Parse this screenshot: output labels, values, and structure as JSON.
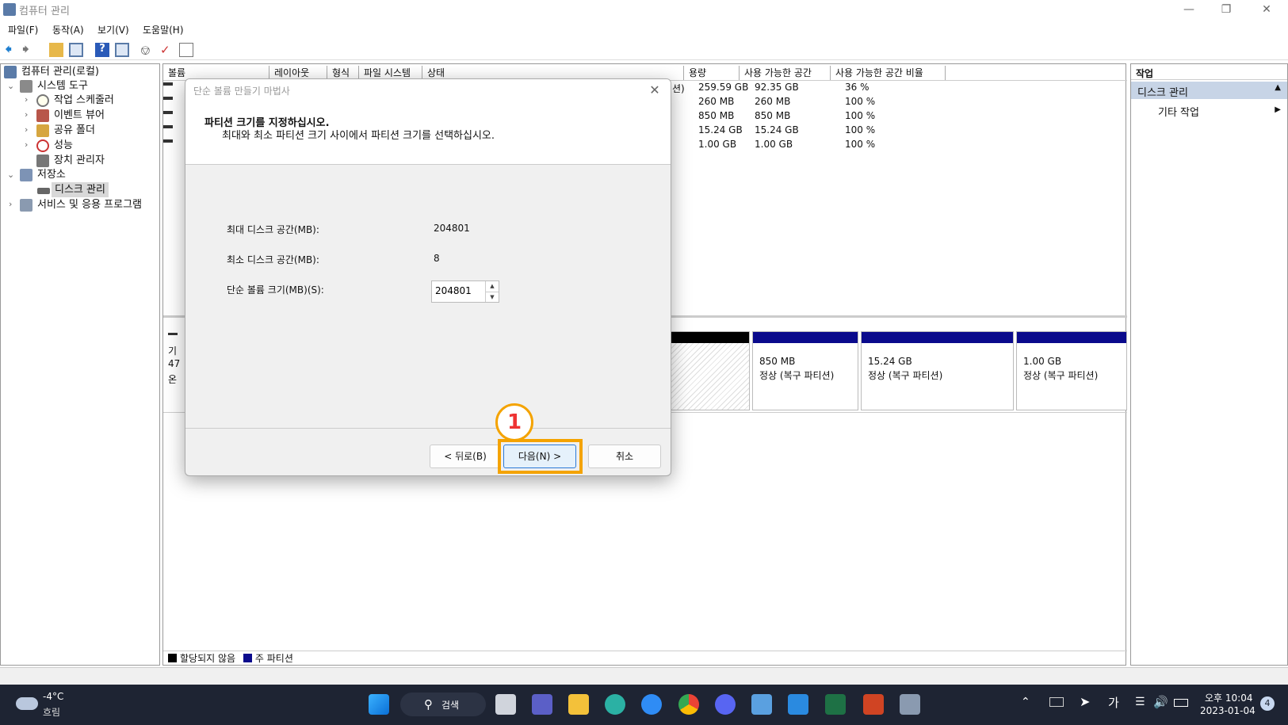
{
  "window": {
    "title": "컴퓨터 관리"
  },
  "menu": [
    "파일(F)",
    "동작(A)",
    "보기(V)",
    "도움말(H)"
  ],
  "tree": {
    "root": "컴퓨터 관리(로컬)",
    "system_tools": "시스템 도구",
    "task_scheduler": "작업 스케줄러",
    "event_viewer": "이벤트 뷰어",
    "shared_folders": "공유 폴더",
    "performance": "성능",
    "device_manager": "장치 관리자",
    "storage": "저장소",
    "disk_management": "디스크 관리",
    "services": "서비스 및 응용 프로그램"
  },
  "volume_table": {
    "headers": [
      "볼륨",
      "레이아웃",
      "형식",
      "파일 시스템",
      "상태",
      "용량",
      "사용 가능한 공간",
      "사용 가능한 공간 비율"
    ],
    "rows": [
      {
        "capacity": "259.59 GB",
        "free": "92.35 GB",
        "pct": "36 %"
      },
      {
        "capacity": "260 MB",
        "free": "260 MB",
        "pct": "100 %"
      },
      {
        "capacity": "850 MB",
        "free": "850 MB",
        "pct": "100 %"
      },
      {
        "capacity": "15.24 GB",
        "free": "15.24 GB",
        "pct": "100 %"
      },
      {
        "capacity": "1.00 GB",
        "free": "1.00 GB",
        "pct": "100 %"
      }
    ],
    "status_fragment": "션)"
  },
  "disk_left": {
    "l1": "기",
    "l2": "47",
    "l3": "온"
  },
  "partitions": [
    {
      "size": "850 MB",
      "status": "정상 (복구 파티션)"
    },
    {
      "size": "15.24 GB",
      "status": "정상 (복구 파티션)"
    },
    {
      "size": "1.00 GB",
      "status": "정상 (복구 파티션)"
    }
  ],
  "legend": {
    "unallocated": "할당되지 않음",
    "primary": "주 파티션"
  },
  "actions": {
    "header": "작업",
    "section": "디스크 관리",
    "more": "기타 작업"
  },
  "dialog": {
    "title": "단순 볼륨 만들기 마법사",
    "heading": "파티션 크기를 지정하십시오.",
    "subheading": "최대와 최소 파티션 크기 사이에서 파티션 크기를 선택하십시오.",
    "max_label": "최대 디스크 공간(MB):",
    "max_value": "204801",
    "min_label": "최소 디스크 공간(MB):",
    "min_value": "8",
    "size_label": "단순 볼륨 크기(MB)(S):",
    "size_value": "204801",
    "back": "< 뒤로(B)",
    "next": "다음(N) >",
    "cancel": "취소"
  },
  "annotation": {
    "step": "1"
  },
  "taskbar": {
    "weather_temp": "-4°C",
    "weather_desc": "흐림",
    "search": "검색",
    "ime": "가",
    "time": "오후 10:04",
    "date": "2023-01-04",
    "notif_count": "4"
  },
  "colors": {
    "accent": "#f4a300",
    "primary_partition": "#0a0a8c",
    "taskbar": "#1e2433"
  }
}
